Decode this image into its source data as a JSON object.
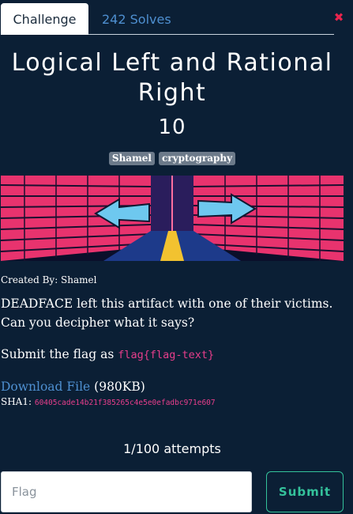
{
  "tabs": {
    "challenge_label": "Challenge",
    "solves_label": "242 Solves"
  },
  "close_symbol": "✖",
  "challenge": {
    "title": "Logical Left and Rational Right",
    "points": "10",
    "tags": [
      "Shamel",
      "cryptography"
    ],
    "created_by": "Created By: Shamel",
    "description": "DEADFACE left this artifact with one of their victims. Can you decipher what it says?",
    "submit_prefix": "Submit the flag as ",
    "flag_format": "flag{flag-text}",
    "download_label": "Download File",
    "file_size": " (980KB)",
    "sha_label": "SHA1: ",
    "sha_value": "60405cade14b21f385265c4e5e0efadbc971e607",
    "attempts": "1/100 attempts"
  },
  "form": {
    "flag_placeholder": "Flag",
    "submit_label": "Submit"
  },
  "colors": {
    "background": "#0b1f35",
    "accent": "#34c29b",
    "link": "#4e8fd0",
    "code": "#e83e8c",
    "close": "#e8244d"
  }
}
